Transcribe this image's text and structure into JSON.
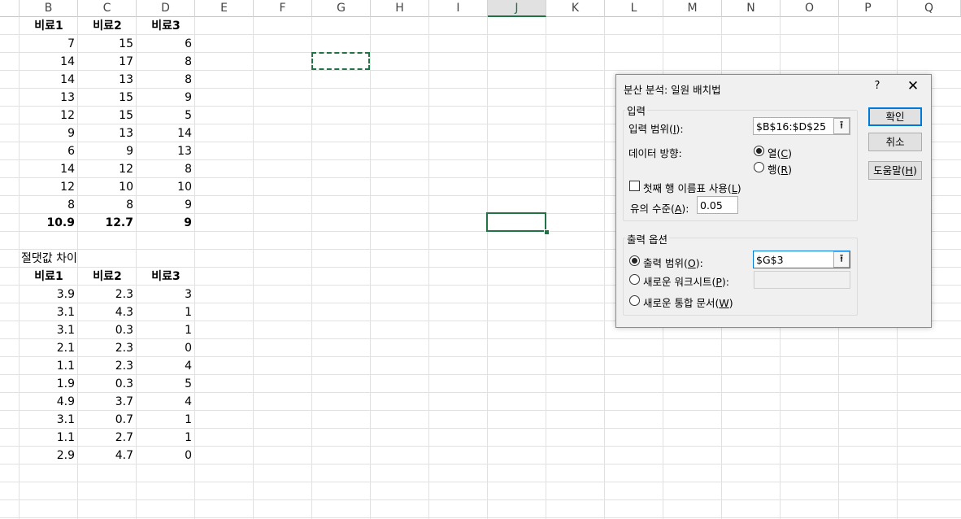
{
  "columns": [
    "B",
    "C",
    "D",
    "E",
    "F",
    "G",
    "H",
    "I",
    "J",
    "K",
    "L",
    "M",
    "N",
    "O",
    "P",
    "Q"
  ],
  "selected_column": "J",
  "table1": {
    "headers": [
      "비료1",
      "비료2",
      "비료3"
    ],
    "rows": [
      [
        "7",
        "15",
        "6"
      ],
      [
        "14",
        "17",
        "8"
      ],
      [
        "14",
        "13",
        "8"
      ],
      [
        "13",
        "15",
        "9"
      ],
      [
        "12",
        "15",
        "5"
      ],
      [
        "9",
        "13",
        "14"
      ],
      [
        "6",
        "9",
        "13"
      ],
      [
        "14",
        "12",
        "8"
      ],
      [
        "12",
        "10",
        "10"
      ],
      [
        "8",
        "8",
        "9"
      ]
    ],
    "averages": [
      "10.9",
      "12.7",
      "9"
    ]
  },
  "table2": {
    "title": "절댓값 차이",
    "headers": [
      "비료1",
      "비료2",
      "비료3"
    ],
    "rows": [
      [
        "3.9",
        "2.3",
        "3"
      ],
      [
        "3.1",
        "4.3",
        "1"
      ],
      [
        "3.1",
        "0.3",
        "1"
      ],
      [
        "2.1",
        "2.3",
        "0"
      ],
      [
        "1.1",
        "2.3",
        "4"
      ],
      [
        "1.9",
        "0.3",
        "5"
      ],
      [
        "4.9",
        "3.7",
        "4"
      ],
      [
        "3.1",
        "0.7",
        "1"
      ],
      [
        "1.1",
        "2.7",
        "1"
      ],
      [
        "2.9",
        "4.7",
        "0"
      ]
    ]
  },
  "dialog": {
    "title": "분산 분석: 일원 배치법",
    "help": "?",
    "close": "✕",
    "input_group": "입력",
    "input_range_label": "입력 범위(",
    "input_range_key": "I",
    "input_range_suffix": "):",
    "input_range_value": "$B$16:$D$25",
    "direction_label": "데이터 방향:",
    "dir_col_label": "열(",
    "dir_col_key": "C",
    "dir_row_label": "행(",
    "dir_row_key": "R",
    "paren_close": ")",
    "first_row_label": "첫째 행 이름표 사용(",
    "first_row_key": "L",
    "alpha_label": "유의 수준(",
    "alpha_key": "A",
    "alpha_suffix": "):",
    "alpha_value": "0.05",
    "output_group": "출력 옵션",
    "output_range_label": "출력 범위(",
    "output_range_key": "O",
    "output_range_suffix": "):",
    "output_range_value": "$G$3",
    "new_sheet_label": "새로운 워크시트(",
    "new_sheet_key": "P",
    "new_sheet_suffix": "):",
    "new_book_label": "새로운 통합 문서(",
    "new_book_key": "W",
    "ok": "확인",
    "cancel": "취소",
    "help_btn_label": "도움말(",
    "help_btn_key": "H",
    "ref_icon": "⭱"
  }
}
